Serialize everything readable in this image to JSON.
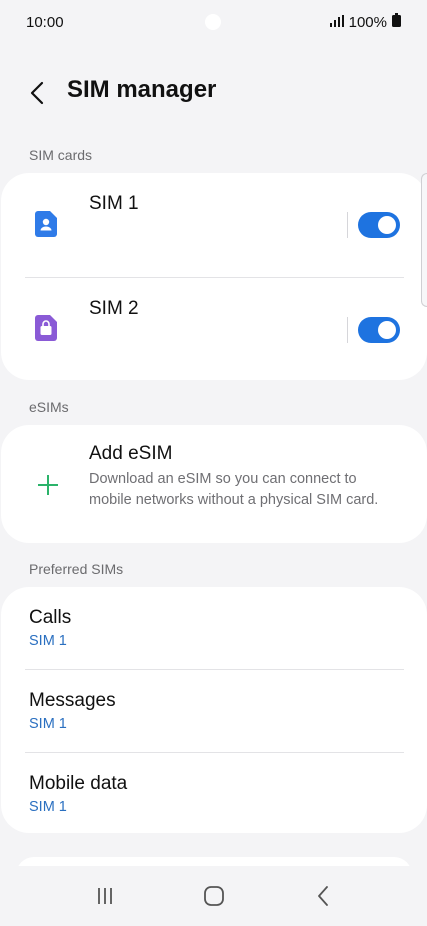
{
  "status": {
    "time": "10:00",
    "battery": "100%"
  },
  "header": {
    "title": "SIM manager"
  },
  "sections": {
    "sim_cards": "SIM cards",
    "esims": "eSIMs",
    "preferred": "Preferred SIMs"
  },
  "sim_cards": [
    {
      "label": "SIM 1",
      "enabled": true,
      "icon": "sim-person-icon",
      "color": "#2f7be8"
    },
    {
      "label": "SIM 2",
      "enabled": true,
      "icon": "sim-bag-icon",
      "color": "#8a5ad6"
    }
  ],
  "add_esim": {
    "title": "Add eSIM",
    "description": "Download an eSIM so you can connect to mobile networks without a physical SIM card.",
    "icon": "plus-icon",
    "icon_color": "#2bb36a"
  },
  "preferred": [
    {
      "title": "Calls",
      "value": "SIM 1"
    },
    {
      "title": "Messages",
      "value": "SIM 1"
    },
    {
      "title": "Mobile data",
      "value": "SIM 1"
    }
  ],
  "accent_color": "#1e73e0"
}
